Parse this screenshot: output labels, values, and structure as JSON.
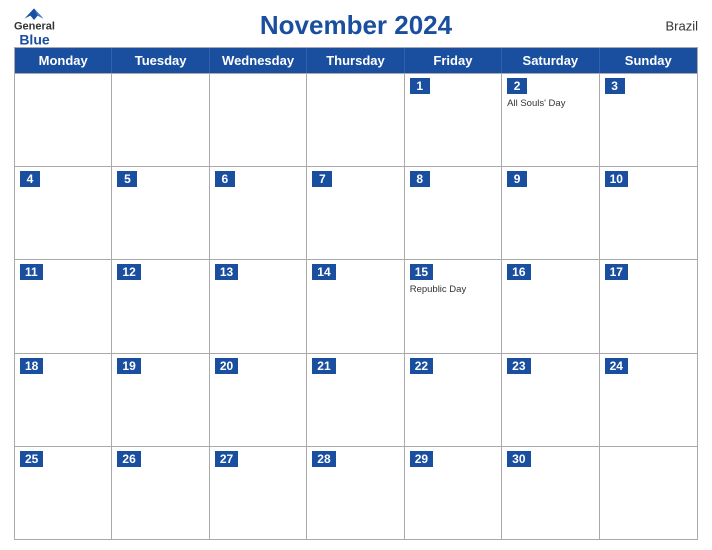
{
  "header": {
    "title": "November 2024",
    "country": "Brazil",
    "logo": {
      "general": "General",
      "blue": "Blue"
    }
  },
  "day_headers": [
    "Monday",
    "Tuesday",
    "Wednesday",
    "Thursday",
    "Friday",
    "Saturday",
    "Sunday"
  ],
  "weeks": [
    [
      {
        "date": "",
        "holiday": ""
      },
      {
        "date": "",
        "holiday": ""
      },
      {
        "date": "",
        "holiday": ""
      },
      {
        "date": "",
        "holiday": ""
      },
      {
        "date": "1",
        "holiday": ""
      },
      {
        "date": "2",
        "holiday": "All Souls' Day"
      },
      {
        "date": "3",
        "holiday": ""
      }
    ],
    [
      {
        "date": "4",
        "holiday": ""
      },
      {
        "date": "5",
        "holiday": ""
      },
      {
        "date": "6",
        "holiday": ""
      },
      {
        "date": "7",
        "holiday": ""
      },
      {
        "date": "8",
        "holiday": ""
      },
      {
        "date": "9",
        "holiday": ""
      },
      {
        "date": "10",
        "holiday": ""
      }
    ],
    [
      {
        "date": "11",
        "holiday": ""
      },
      {
        "date": "12",
        "holiday": ""
      },
      {
        "date": "13",
        "holiday": ""
      },
      {
        "date": "14",
        "holiday": ""
      },
      {
        "date": "15",
        "holiday": "Republic Day"
      },
      {
        "date": "16",
        "holiday": ""
      },
      {
        "date": "17",
        "holiday": ""
      }
    ],
    [
      {
        "date": "18",
        "holiday": ""
      },
      {
        "date": "19",
        "holiday": ""
      },
      {
        "date": "20",
        "holiday": ""
      },
      {
        "date": "21",
        "holiday": ""
      },
      {
        "date": "22",
        "holiday": ""
      },
      {
        "date": "23",
        "holiday": ""
      },
      {
        "date": "24",
        "holiday": ""
      }
    ],
    [
      {
        "date": "25",
        "holiday": ""
      },
      {
        "date": "26",
        "holiday": ""
      },
      {
        "date": "27",
        "holiday": ""
      },
      {
        "date": "28",
        "holiday": ""
      },
      {
        "date": "29",
        "holiday": ""
      },
      {
        "date": "30",
        "holiday": ""
      },
      {
        "date": "",
        "holiday": ""
      }
    ]
  ]
}
